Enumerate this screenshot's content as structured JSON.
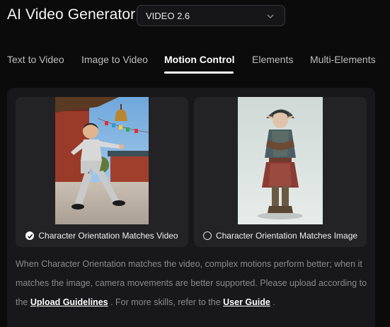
{
  "header": {
    "title": "AI Video Generator",
    "model_select": {
      "value": "VIDEO 2.6",
      "icon": "chevron-down-icon"
    }
  },
  "tabs": [
    {
      "label": "Text to Video",
      "active": false
    },
    {
      "label": "Image to Video",
      "active": false
    },
    {
      "label": "Motion Control",
      "active": true
    },
    {
      "label": "Elements",
      "active": false
    },
    {
      "label": "Multi-Elements",
      "active": false
    }
  ],
  "options": [
    {
      "label": "Character Orientation Matches Video",
      "selected": true
    },
    {
      "label": "Character Orientation Matches Image",
      "selected": false
    }
  ],
  "description": {
    "text_1": "When Character Orientation matches the video, complex motions perform better; when it matches the image, camera movements are better supported. Please upload according to the ",
    "link_1": "Upload Guidelines",
    "text_2": " . For more skills, refer to the ",
    "link_2": "User Guide",
    "text_3": " ."
  },
  "colors": {
    "background": "#0b0b0c",
    "panel": "#18181a",
    "card": "#232325",
    "accent": "#ffffff",
    "muted_text": "#8a8a8a"
  }
}
